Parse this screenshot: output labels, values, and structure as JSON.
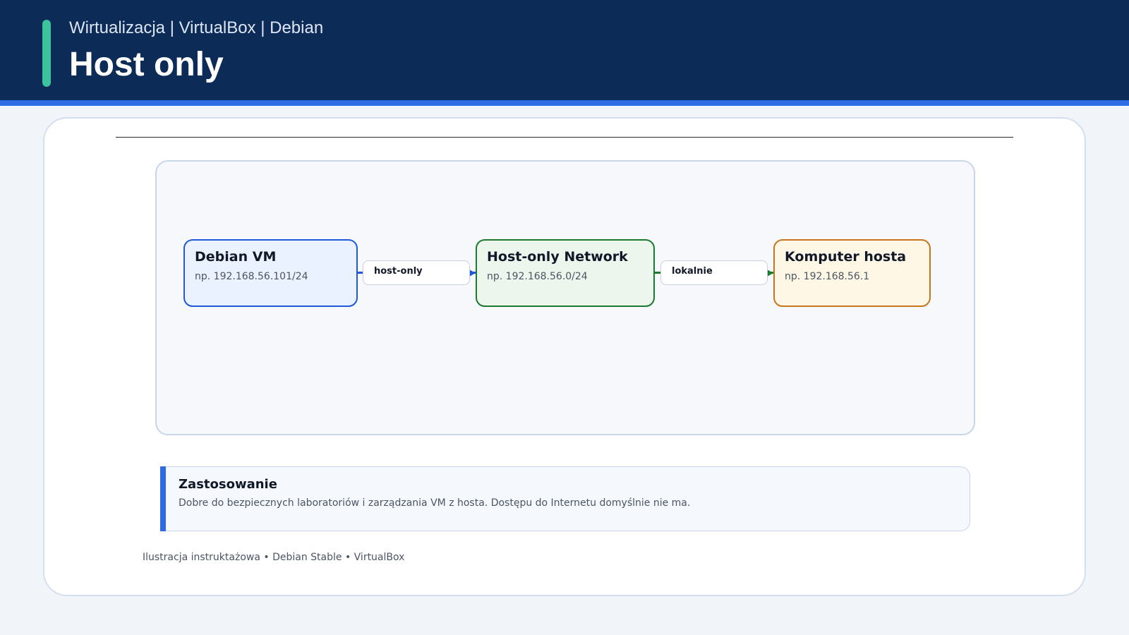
{
  "header": {
    "subtitle": "Wirtualizacja | VirtualBox | Debian",
    "title": "Host only",
    "colors": {
      "background": "#0d2b57",
      "stripe": "#2d6be4",
      "accent": "#3cc39e"
    }
  },
  "diagram": {
    "nodes": [
      {
        "title": "Debian VM",
        "subtitle": "np. 192.168.56.101/24",
        "border_color": "#2058d9",
        "fill_color": "#eaf2ff"
      },
      {
        "title": "Host-only Network",
        "subtitle": "np. 192.168.56.0/24",
        "border_color": "#1b7a2e",
        "fill_color": "#ecf6ec"
      },
      {
        "title": "Komputer hosta",
        "subtitle": "np. 192.168.56.1",
        "border_color": "#c7761b",
        "fill_color": "#fff7e6"
      }
    ],
    "edges": [
      {
        "from": "Debian VM",
        "to": "Host-only Network",
        "label": "host-only",
        "color": "#2058d9"
      },
      {
        "from": "Host-only Network",
        "to": "Komputer hosta",
        "label": "lokalnie",
        "color": "#1b7a2e"
      }
    ]
  },
  "info": {
    "title": "Zastosowanie",
    "text": "Dobre do bezpiecznych laboratoriów i zarządzania VM z hosta. Dostępu do Internetu domyślnie nie ma.",
    "accent_color": "#2d6be4"
  },
  "footer": {
    "note": "Ilustracja instruktażowa • Debian Stable • VirtualBox"
  }
}
